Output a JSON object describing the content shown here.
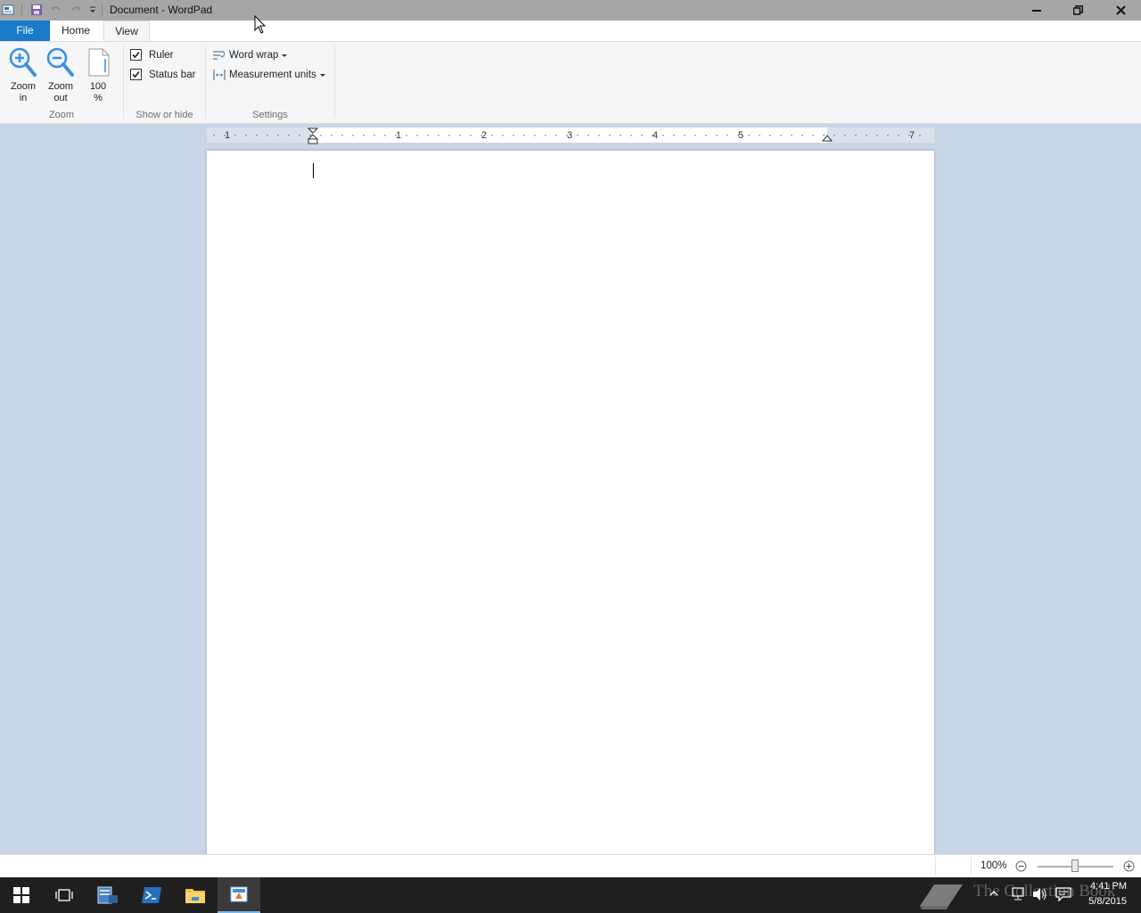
{
  "window": {
    "title": "Document - WordPad"
  },
  "tabs": {
    "file": "File",
    "home": "Home",
    "view": "View"
  },
  "ribbon": {
    "zoom_group": {
      "label": "Zoom",
      "zoom_in": [
        "Zoom",
        "in"
      ],
      "zoom_out": [
        "Zoom",
        "out"
      ],
      "zoom_100": [
        "100",
        "%"
      ]
    },
    "show_hide_group": {
      "label": "Show or hide",
      "ruler": {
        "label": "Ruler",
        "checked": true
      },
      "status_bar": {
        "label": "Status bar",
        "checked": true
      }
    },
    "settings_group": {
      "label": "Settings",
      "word_wrap": "Word wrap",
      "measurement_units": "Measurement units"
    }
  },
  "ruler": {
    "numbers": [
      "1",
      "1",
      "2",
      "3",
      "4",
      "5",
      "7"
    ]
  },
  "statusbar": {
    "zoom_percent": "100%",
    "zoom_level": 1.0
  },
  "taskbar": {
    "time": "4:41 PM",
    "date": "5/8/2015",
    "watermark": "The Collection Book"
  },
  "colors": {
    "accent": "#1979ca",
    "workspace": "#c9d6e8",
    "taskbar": "#1f1f1f"
  }
}
